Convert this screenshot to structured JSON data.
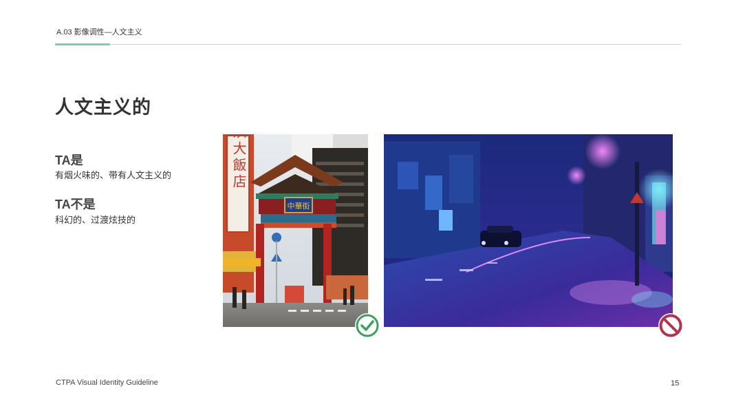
{
  "header": {
    "section_label": "A.03   影像调性—人文主义"
  },
  "title": "人文主义的",
  "definition": {
    "is_heading": "TA是",
    "is_desc": "有烟火味的、带有人文主义的",
    "isnot_heading": "TA不是",
    "isnot_desc": "科幻的、过渡炫技的"
  },
  "images": {
    "good": {
      "sign_vertical": "横浜大飯店",
      "gate_plaque": "中華街",
      "badge": "check-icon",
      "badge_color": "#3aa05a"
    },
    "bad": {
      "badge": "prohibited-icon",
      "badge_color": "#b3334f"
    }
  },
  "footer": {
    "guideline": "CTPA Visual Identity Guideline",
    "page": "15"
  },
  "colors": {
    "accent": "#7fc8b8",
    "rule": "#cfcfcf",
    "text": "#333333"
  }
}
